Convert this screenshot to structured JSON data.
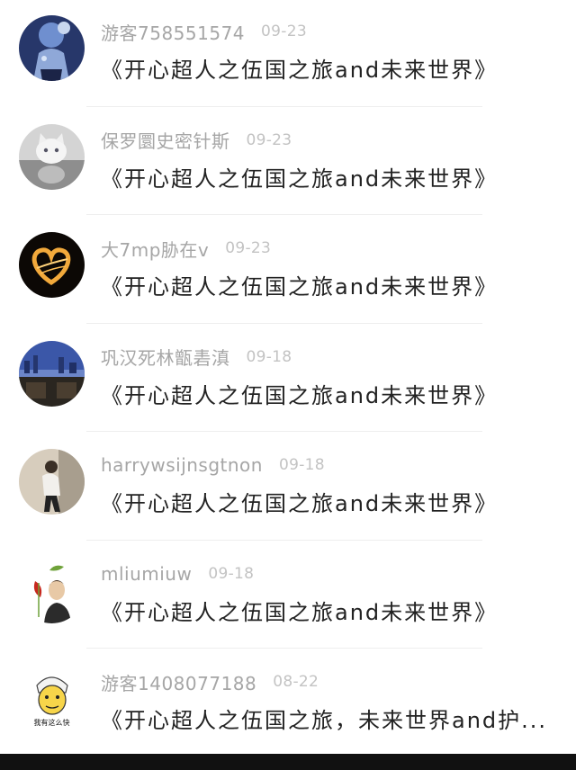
{
  "comments": [
    {
      "username": "游客758551574",
      "date": "09-23",
      "content": "《开心超人之伍国之旅and未来世界》",
      "avatar": "astronaut-avatar"
    },
    {
      "username": "保罗圜史密针斯",
      "date": "09-23",
      "content": "《开心超人之伍国之旅and未来世界》",
      "avatar": "white-cat-avatar"
    },
    {
      "username": "大7mp胁在v",
      "date": "09-23",
      "content": "《开心超人之伍国之旅and未来世界》",
      "avatar": "light-heart-avatar"
    },
    {
      "username": "巩汉死林甑砉滇",
      "date": "09-18",
      "content": "《开心超人之伍国之旅and未来世界》",
      "avatar": "city-night-avatar"
    },
    {
      "username": "harrywsijnsgtnon",
      "date": "09-18",
      "content": "《开心超人之伍国之旅and未来世界》",
      "avatar": "person-photo-avatar"
    },
    {
      "username": "mliumiuw",
      "date": "09-18",
      "content": "《开心超人之伍国之旅and未来世界》",
      "avatar": "flower-portrait-avatar"
    },
    {
      "username": "游客1408077188",
      "date": "08-22",
      "content": "《开心超人之伍国之旅，未来世界and护...",
      "avatar": "cartoon-face-avatar",
      "avatar_caption": "我有这么快"
    }
  ]
}
